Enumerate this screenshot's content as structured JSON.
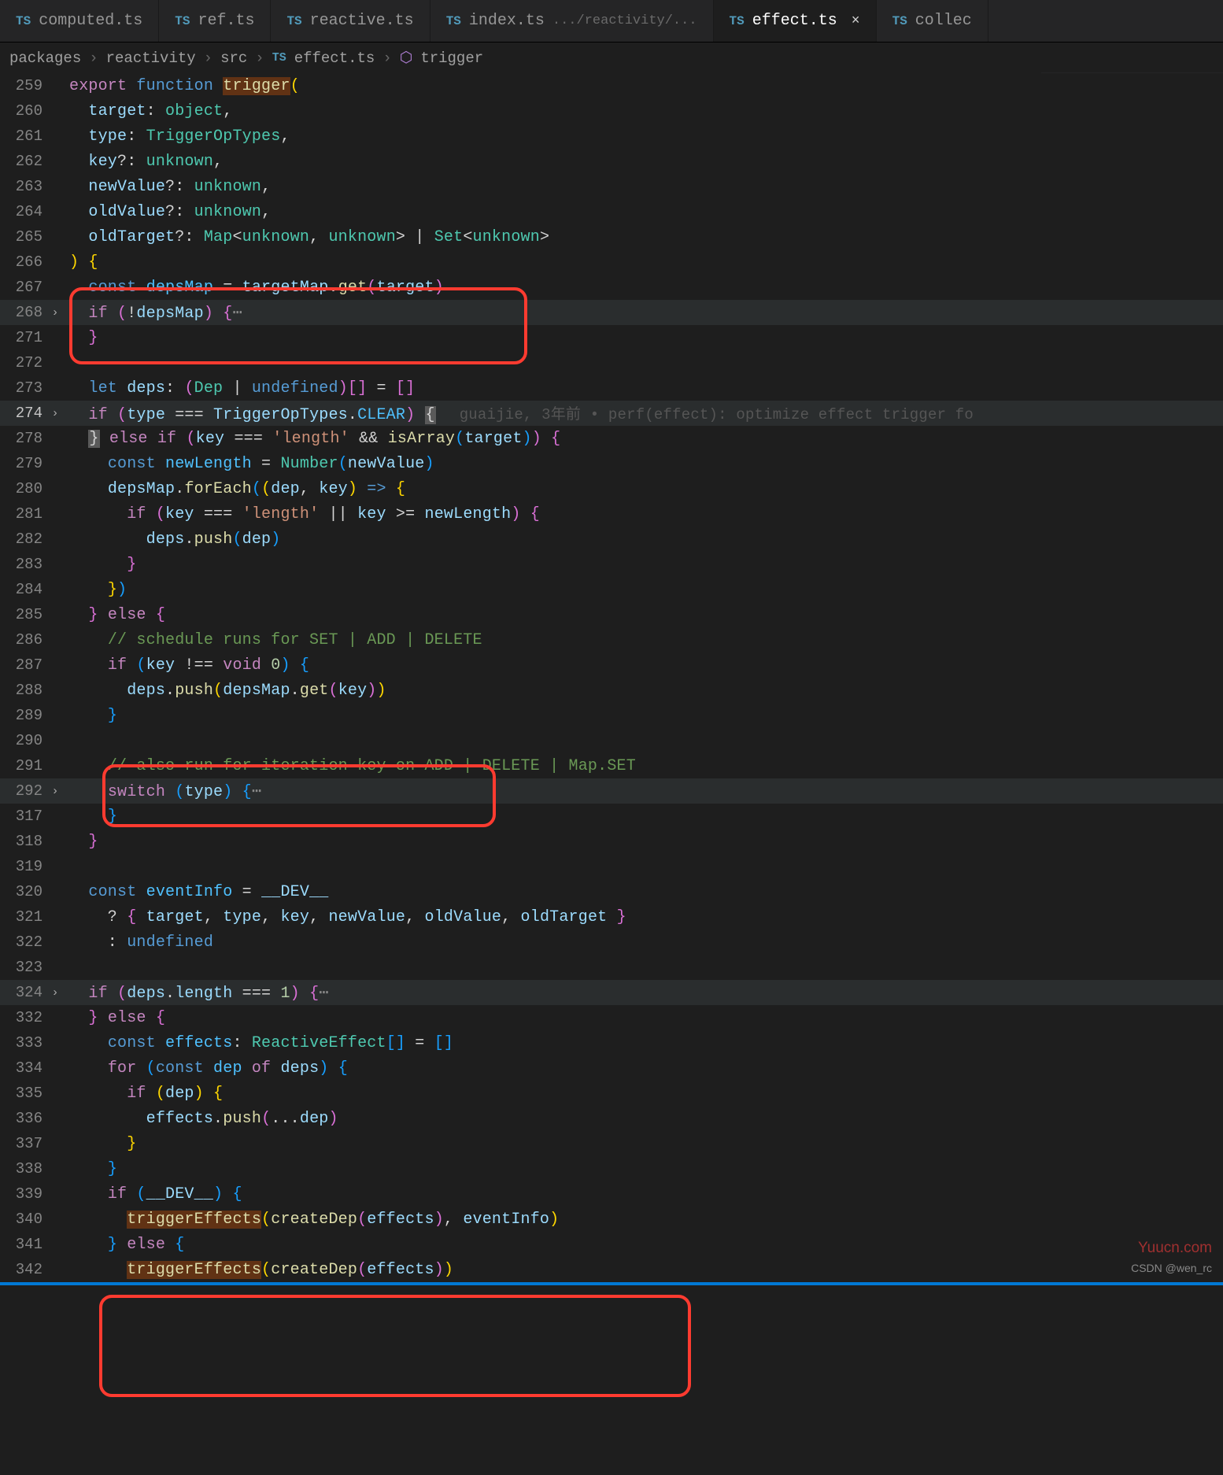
{
  "tabs": [
    {
      "icon": "TS",
      "name": "computed.ts"
    },
    {
      "icon": "TS",
      "name": "ref.ts"
    },
    {
      "icon": "TS",
      "name": "reactive.ts"
    },
    {
      "icon": "TS",
      "name": "index.ts",
      "path": ".../reactivity/..."
    },
    {
      "icon": "TS",
      "name": "effect.ts",
      "active": true,
      "close": "×"
    },
    {
      "icon": "TS",
      "name": "collec"
    }
  ],
  "breadcrumbs": {
    "parts": [
      "packages",
      "reactivity",
      "src"
    ],
    "fileIcon": "TS",
    "file": "effect.ts",
    "symbolIcon": "⬡",
    "symbol": "trigger"
  },
  "symbolNav": {
    "chevron": "›",
    "label": "trigger"
  },
  "blame": "guaijie, 3年前 • perf(effect): optimize effect trigger fo",
  "lines": {
    "l259": {
      "n": "259"
    },
    "l260": {
      "n": "260"
    },
    "l261": {
      "n": "261"
    },
    "l262": {
      "n": "262"
    },
    "l263": {
      "n": "263"
    },
    "l264": {
      "n": "264"
    },
    "l265": {
      "n": "265"
    },
    "l266": {
      "n": "266"
    },
    "l267": {
      "n": "267"
    },
    "l268": {
      "n": "268"
    },
    "l271": {
      "n": "271"
    },
    "l272": {
      "n": "272"
    },
    "l273": {
      "n": "273"
    },
    "l274": {
      "n": "274"
    },
    "l278": {
      "n": "278"
    },
    "l279": {
      "n": "279"
    },
    "l280": {
      "n": "280"
    },
    "l281": {
      "n": "281"
    },
    "l282": {
      "n": "282"
    },
    "l283": {
      "n": "283"
    },
    "l284": {
      "n": "284"
    },
    "l285": {
      "n": "285"
    },
    "l286": {
      "n": "286"
    },
    "l287": {
      "n": "287"
    },
    "l288": {
      "n": "288"
    },
    "l289": {
      "n": "289"
    },
    "l290": {
      "n": "290"
    },
    "l291": {
      "n": "291"
    },
    "l292": {
      "n": "292"
    },
    "l317": {
      "n": "317"
    },
    "l318": {
      "n": "318"
    },
    "l319": {
      "n": "319"
    },
    "l320": {
      "n": "320"
    },
    "l321": {
      "n": "321"
    },
    "l322": {
      "n": "322"
    },
    "l323": {
      "n": "323"
    },
    "l324": {
      "n": "324"
    },
    "l332": {
      "n": "332"
    },
    "l333": {
      "n": "333"
    },
    "l334": {
      "n": "334"
    },
    "l335": {
      "n": "335"
    },
    "l336": {
      "n": "336"
    },
    "l337": {
      "n": "337"
    },
    "l338": {
      "n": "338"
    },
    "l339": {
      "n": "339"
    },
    "l340": {
      "n": "340"
    },
    "l341": {
      "n": "341"
    },
    "l342": {
      "n": "342"
    }
  },
  "code": {
    "export": "export",
    "function": "function",
    "trigger": "trigger",
    "target": "target",
    "object": "object",
    "type": "type",
    "TriggerOpTypes": "TriggerOpTypes",
    "key": "key",
    "unknown": "unknown",
    "newValue": "newValue",
    "oldValue": "oldValue",
    "oldTarget": "oldTarget",
    "Map": "Map",
    "Set": "Set",
    "const": "const",
    "let": "let",
    "if": "if",
    "else": "else",
    "for": "for",
    "of": "of",
    "switch": "switch",
    "void": "void",
    "depsMap": "depsMap",
    "targetMap": "targetMap",
    "get": "get",
    "deps": "deps",
    "Dep": "Dep",
    "undefined": "undefined",
    "CLEAR": "CLEAR",
    "length": "'length'",
    "isArray": "isArray",
    "newLength": "newLength",
    "Number": "Number",
    "forEach": "forEach",
    "dep": "dep",
    "push": "push",
    "comment1": "// schedule runs for SET | ADD | DELETE",
    "comment2": "// also run for iteration key on ADD | DELETE | Map.SET",
    "eventInfo": "eventInfo",
    "__DEV__": "__DEV__",
    "effects": "effects",
    "ReactiveEffect": "ReactiveEffect",
    "triggerEffects": "triggerEffects",
    "createDep": "createDep",
    "num1": "1",
    "num0": "0"
  },
  "watermark1": "Yuucn.com",
  "watermark2": "CSDN @wen_rc"
}
